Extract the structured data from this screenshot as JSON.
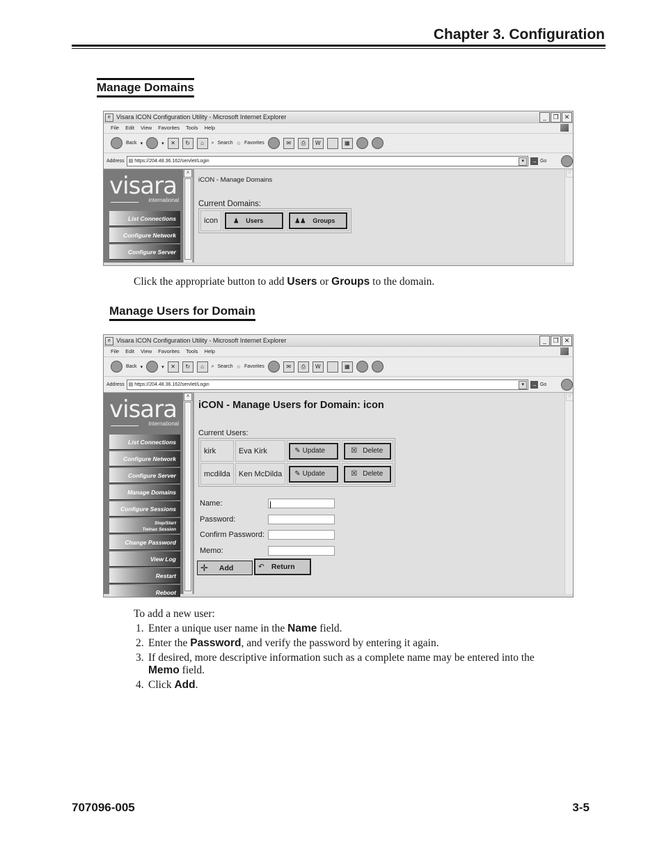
{
  "header": {
    "chapter": "Chapter 3.  Configuration"
  },
  "section1": {
    "title": "Manage Domains",
    "caption": {
      "pre": "Click the appropriate button to add ",
      "b1": "Users",
      "mid": " or ",
      "b2": "Groups",
      "post": " to the domain."
    }
  },
  "section2": {
    "title": "Manage Users for Domain",
    "intro": "To add a new user:",
    "steps": [
      {
        "num": "1.",
        "pre": "Enter a unique user name in the ",
        "bold": "Name",
        "post": " field."
      },
      {
        "num": "2.",
        "pre": "Enter the ",
        "bold": "Password",
        "post": ", and verify the password by entering it again."
      },
      {
        "num": "3.",
        "pre": "If desired, more descriptive information such as a complete name may be entered into the ",
        "bold": "Memo",
        "post": " field."
      },
      {
        "num": "4.",
        "pre": "Click ",
        "bold": "Add",
        "post": "."
      }
    ]
  },
  "browser": {
    "title": "Visara ICON Configuration Utility - Microsoft Internet Explorer",
    "menu": [
      "File",
      "Edit",
      "View",
      "Favorites",
      "Tools",
      "Help"
    ],
    "toolbar": {
      "back": "Back",
      "search": "Search",
      "favorites": "Favorites"
    },
    "address_label": "Address",
    "address": "https://204.48.36.162/servlet/Login",
    "go": "Go",
    "logo": {
      "brand": "visara",
      "sub": "international"
    }
  },
  "screen1": {
    "nav": [
      "List Connections",
      "Configure Network",
      "Configure Server"
    ],
    "heading": "iCON - Manage Domains",
    "current_label": "Current Domains:",
    "domain": "icon",
    "users_btn": "Users",
    "groups_btn": "Groups"
  },
  "screen2": {
    "nav": [
      "List Connections",
      "Configure Network",
      "Configure Server",
      "Manage Domains",
      "Configure Sessions",
      "Stop/Start",
      "Twinax Session",
      "Change Password",
      "View Log",
      "Restart",
      "Reboot"
    ],
    "heading": "iCON - Manage Users for Domain: icon",
    "current_label": "Current Users:",
    "users": [
      {
        "id": "kirk",
        "name": "Eva Kirk"
      },
      {
        "id": "mcdilda",
        "name": "Ken McDilda"
      }
    ],
    "update_btn": "Update",
    "delete_btn": "Delete",
    "form": {
      "name": "Name:",
      "password": "Password:",
      "confirm": "Confirm Password:",
      "memo": "Memo:"
    },
    "add_btn": "Add",
    "return_btn": "Return"
  },
  "footer": {
    "doc_number": "707096-005",
    "page": "3-5"
  }
}
